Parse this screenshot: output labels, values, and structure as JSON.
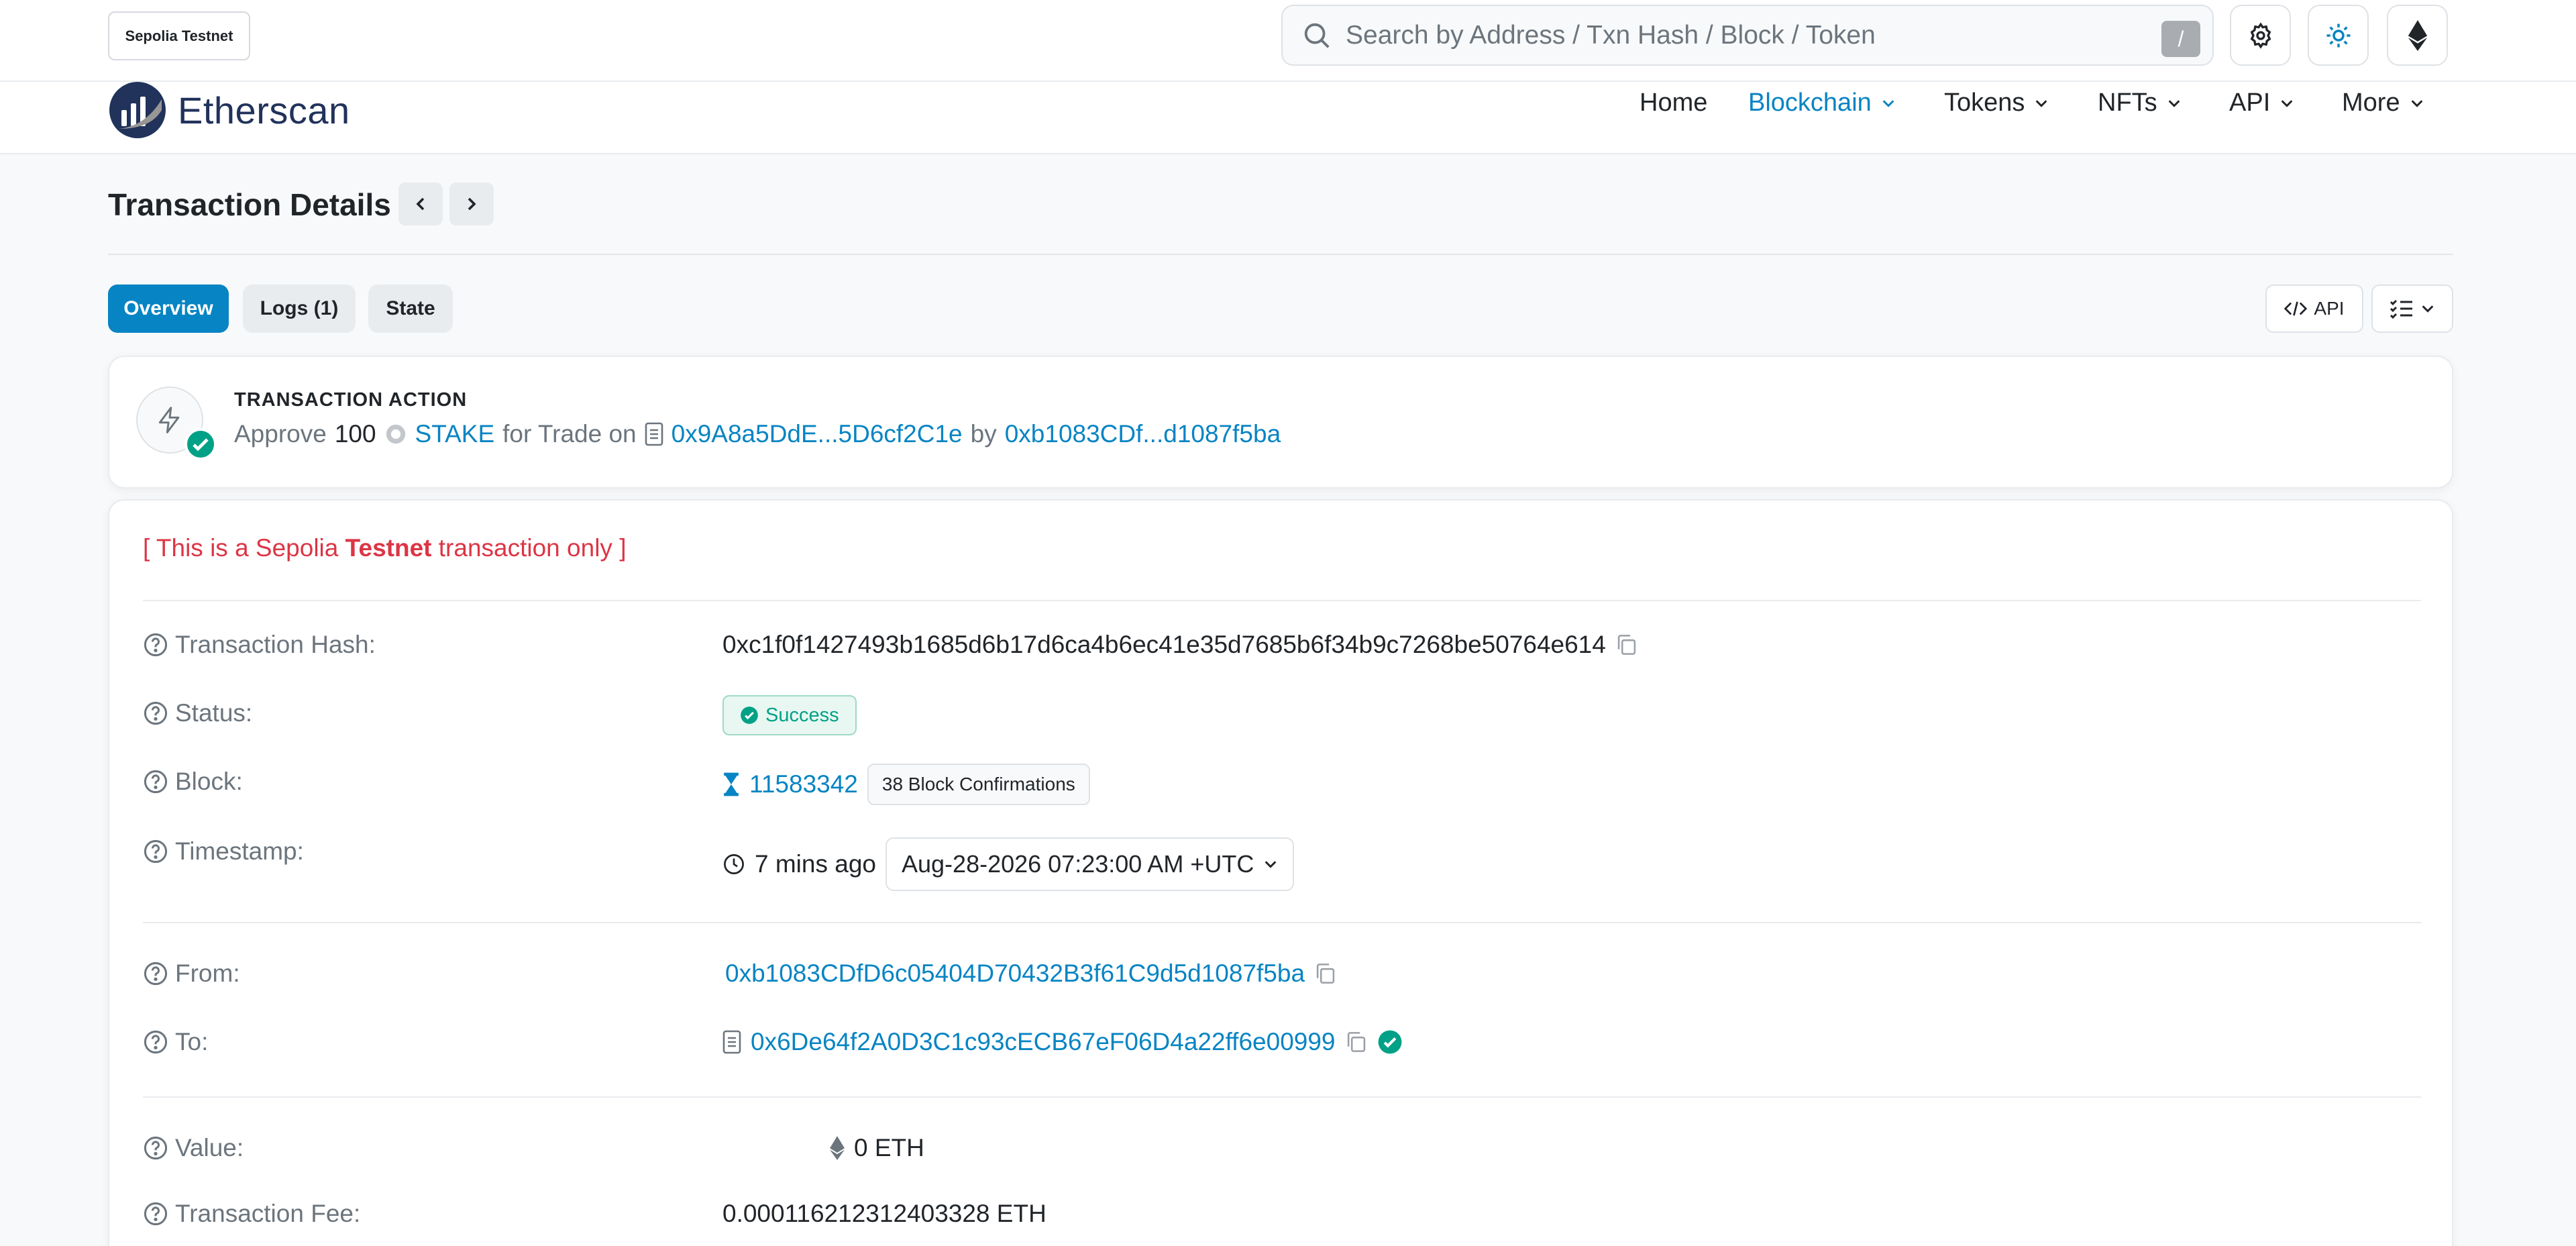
{
  "topbar": {
    "network": "Sepolia Testnet",
    "search_placeholder": "Search by Address / Txn Hash / Block / Token",
    "search_shortcut": "/"
  },
  "nav": {
    "brand": "Etherscan",
    "items": [
      {
        "label": "Home",
        "active": false,
        "dropdown": false
      },
      {
        "label": "Blockchain",
        "active": true,
        "dropdown": true
      },
      {
        "label": "Tokens",
        "active": false,
        "dropdown": true
      },
      {
        "label": "NFTs",
        "active": false,
        "dropdown": true
      },
      {
        "label": "API",
        "active": false,
        "dropdown": true
      },
      {
        "label": "More",
        "active": false,
        "dropdown": true
      }
    ]
  },
  "page": {
    "title": "Transaction Details",
    "tabs": [
      {
        "label": "Overview",
        "active": true
      },
      {
        "label": "Logs (1)",
        "active": false
      },
      {
        "label": "State",
        "active": false
      }
    ],
    "api_button": "API"
  },
  "action": {
    "heading": "TRANSACTION ACTION",
    "verb": "Approve",
    "amount": "100",
    "token": "STAKE",
    "for_trade_on": "for Trade on",
    "contract": "0x9A8a5DdE...5D6cf2C1e",
    "by": "by",
    "sender": "0xb1083CDf...d1087f5ba"
  },
  "details": {
    "warning_prefix": "[ This is a Sepolia ",
    "warning_bold": "Testnet",
    "warning_suffix": " transaction only ]",
    "rows": {
      "hash": {
        "label": "Transaction Hash:",
        "value": "0xc1f0f1427493b1685d6b17d6ca4b6ec41e35d7685b6f34b9c7268be50764e614"
      },
      "status": {
        "label": "Status:",
        "value": "Success"
      },
      "block": {
        "label": "Block:",
        "value": "11583342",
        "confirmations": "38 Block Confirmations"
      },
      "timestamp": {
        "label": "Timestamp:",
        "ago": "7 mins ago",
        "value": "Aug-28-2026 07:23:00 AM +UTC"
      },
      "from": {
        "label": "From:",
        "value": "0xb1083CDfD6c05404D70432B3f61C9d5d1087f5ba"
      },
      "to": {
        "label": "To:",
        "value": "0x6De64f2A0D3C1c93cECB67eF06D4a22ff6e00999"
      },
      "value": {
        "label": "Value:",
        "value": "0 ETH"
      },
      "fee": {
        "label": "Transaction Fee:",
        "value": "0.000116212312403328 ETH"
      }
    }
  },
  "colors": {
    "accent": "#0784c3",
    "success": "#00a186",
    "danger": "#dc3545",
    "brand": "#21325b"
  }
}
